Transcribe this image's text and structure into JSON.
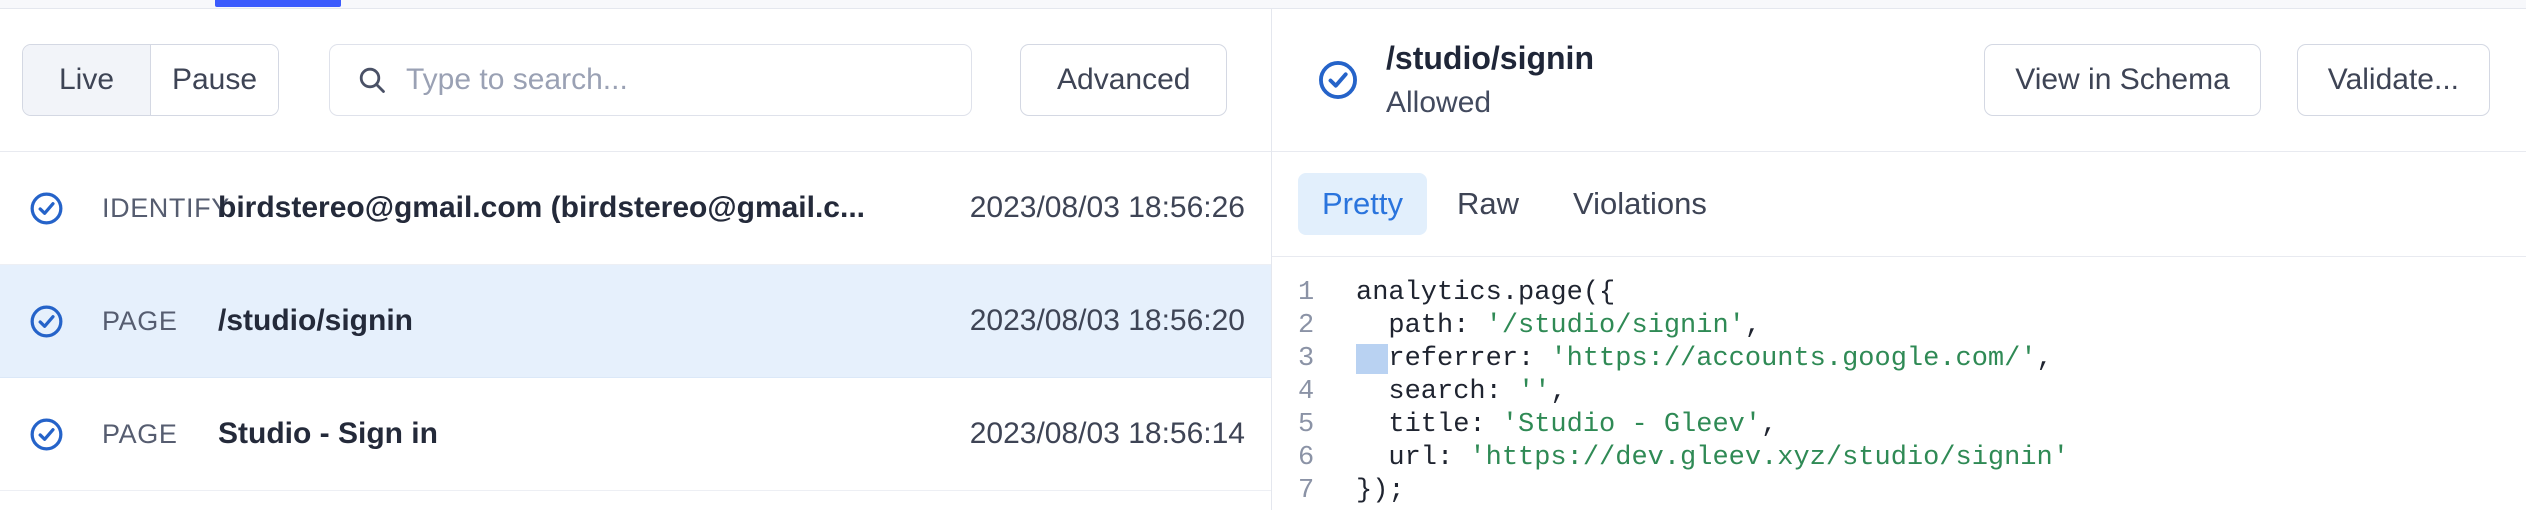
{
  "window": {
    "active_tab_indicator": true,
    "accent_color": "#3b5bfd",
    "selected_row_color": "#e6f0fc",
    "string_color": "#2f8a55"
  },
  "toolbar": {
    "live_label": "Live",
    "pause_label": "Pause",
    "live_active": true,
    "search_placeholder": "Type to search...",
    "search_value": "",
    "advanced_label": "Advanced"
  },
  "events": [
    {
      "status": "allowed",
      "type": "IDENTIFY",
      "label": "birdstereo@gmail.com (birdstereo@gmail.c...",
      "timestamp": "2023/08/03 18:56:26",
      "selected": false
    },
    {
      "status": "allowed",
      "type": "PAGE",
      "label": "/studio/signin",
      "timestamp": "2023/08/03 18:56:20",
      "selected": true
    },
    {
      "status": "allowed",
      "type": "PAGE",
      "label": "Studio - Sign in",
      "timestamp": "2023/08/03 18:56:14",
      "selected": false
    }
  ],
  "detail": {
    "status_icon": "check-circle-icon",
    "title": "/studio/signin",
    "subtitle": "Allowed",
    "view_in_schema_label": "View in Schema",
    "validate_label": "Validate...",
    "tabs": [
      {
        "label": "Pretty",
        "active": true
      },
      {
        "label": "Raw",
        "active": false
      },
      {
        "label": "Violations",
        "active": false
      }
    ],
    "code": [
      {
        "number": "1",
        "segments": [
          {
            "text": "analytics.page({",
            "kind": "plain"
          }
        ]
      },
      {
        "number": "2",
        "segments": [
          {
            "text": "  path: ",
            "kind": "plain"
          },
          {
            "text": "'/studio/signin'",
            "kind": "string"
          },
          {
            "text": ",",
            "kind": "plain"
          }
        ]
      },
      {
        "number": "3",
        "segments": [
          {
            "text": "  ",
            "kind": "selected"
          },
          {
            "text": "referrer: ",
            "kind": "plain"
          },
          {
            "text": "'https://accounts.google.com/'",
            "kind": "string"
          },
          {
            "text": ",",
            "kind": "plain"
          }
        ]
      },
      {
        "number": "4",
        "segments": [
          {
            "text": "  search: ",
            "kind": "plain"
          },
          {
            "text": "''",
            "kind": "string"
          },
          {
            "text": ",",
            "kind": "plain"
          }
        ]
      },
      {
        "number": "5",
        "segments": [
          {
            "text": "  title: ",
            "kind": "plain"
          },
          {
            "text": "'Studio - Gleev'",
            "kind": "string"
          },
          {
            "text": ",",
            "kind": "plain"
          }
        ]
      },
      {
        "number": "6",
        "segments": [
          {
            "text": "  url: ",
            "kind": "plain"
          },
          {
            "text": "'https://dev.gleev.xyz/studio/signin'",
            "kind": "string"
          }
        ]
      },
      {
        "number": "7",
        "segments": [
          {
            "text": "});",
            "kind": "plain"
          }
        ]
      }
    ]
  }
}
